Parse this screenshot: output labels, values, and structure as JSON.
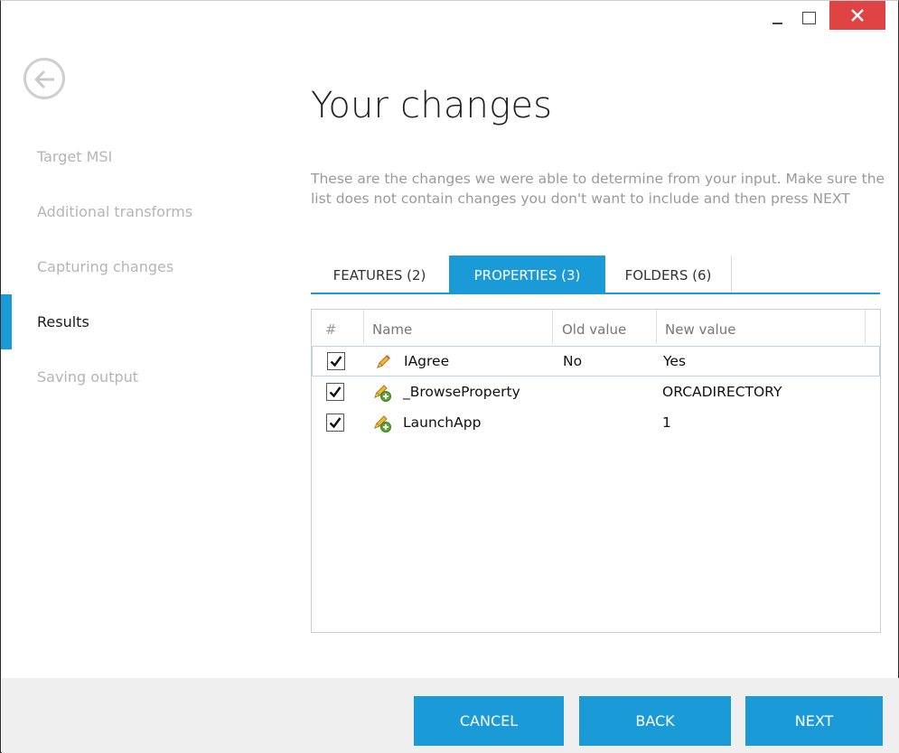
{
  "window": {
    "controls": {
      "minimize": "minimize-icon",
      "maximize": "maximize-icon",
      "close": "close-icon"
    }
  },
  "sidebar": {
    "back_icon": "back-arrow-icon",
    "items": [
      {
        "label": "Target MSI",
        "active": false
      },
      {
        "label": "Additional transforms",
        "active": false
      },
      {
        "label": "Capturing changes",
        "active": false
      },
      {
        "label": "Results",
        "active": true
      },
      {
        "label": "Saving output",
        "active": false
      }
    ]
  },
  "main": {
    "title": "Your changes",
    "description": "These are the changes we were able to determine from your input. Make sure the list does not contain changes you don't want to include and then press NEXT",
    "tabs": [
      {
        "label": "FEATURES (2)",
        "selected": false
      },
      {
        "label": "PROPERTIES (3)",
        "selected": true
      },
      {
        "label": "FOLDERS (6)",
        "selected": false
      }
    ],
    "grid": {
      "columns": [
        "#",
        "Name",
        "Old value",
        "New value"
      ],
      "rows": [
        {
          "checked": true,
          "icon": "pencil-edit-icon",
          "name": "IAgree",
          "old": "No",
          "new": "Yes"
        },
        {
          "checked": true,
          "icon": "pencil-add-icon",
          "name": "_BrowseProperty",
          "old": "",
          "new": "ORCADIRECTORY"
        },
        {
          "checked": true,
          "icon": "pencil-add-icon",
          "name": "LaunchApp",
          "old": "",
          "new": "1"
        }
      ]
    }
  },
  "footer": {
    "cancel": "CANCEL",
    "back": "BACK",
    "next": "NEXT"
  },
  "colors": {
    "accent": "#1b9ad8",
    "close": "#e04343",
    "muted_text": "#b5b5b5",
    "footer_bg": "#efefef"
  }
}
